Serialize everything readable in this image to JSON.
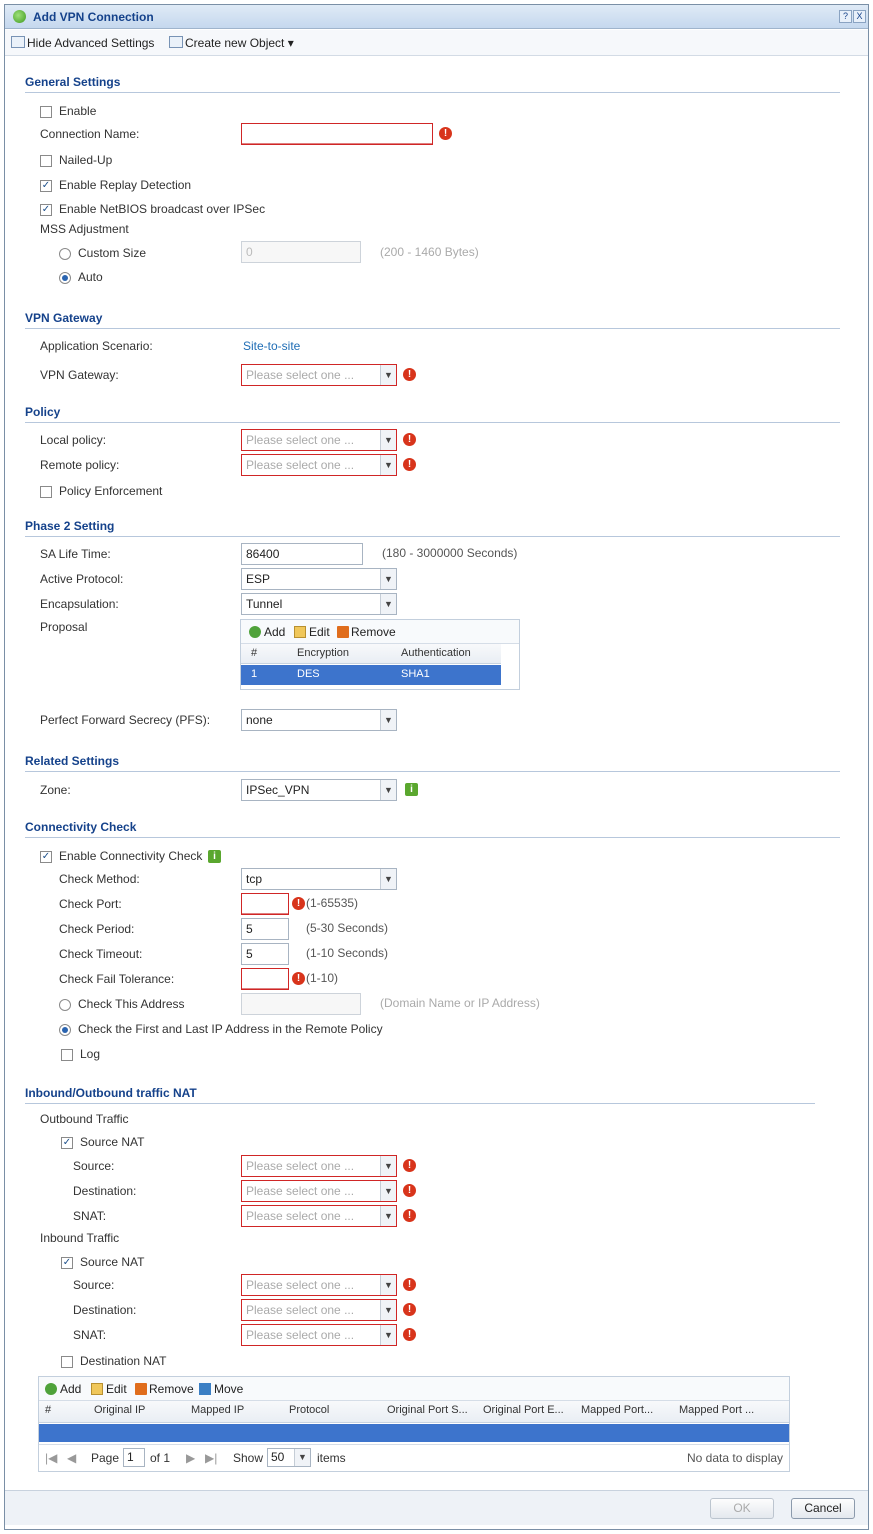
{
  "window": {
    "title": "Add VPN Connection",
    "help_label": "?",
    "close_label": "X"
  },
  "toolbar": {
    "hide_advanced": "Hide Advanced Settings",
    "create_object": "Create new Object"
  },
  "general": {
    "heading": "General Settings",
    "enable": "Enable",
    "connection_name_label": "Connection Name:",
    "nailed_up": "Nailed-Up",
    "replay_detection": "Enable Replay Detection",
    "netbios": "Enable NetBIOS broadcast over IPSec",
    "mss_label": "MSS Adjustment",
    "custom_size": "Custom Size",
    "custom_size_value": "0",
    "custom_size_hint": "(200 - 1460 Bytes)",
    "auto": "Auto"
  },
  "gateway": {
    "heading": "VPN Gateway",
    "scenario_label": "Application Scenario:",
    "scenario_value": "Site-to-site",
    "gateway_label": "VPN Gateway:",
    "placeholder": "Please select one ..."
  },
  "policy": {
    "heading": "Policy",
    "local_label": "Local policy:",
    "remote_label": "Remote policy:",
    "enforcement": "Policy Enforcement",
    "placeholder": "Please select one ..."
  },
  "phase2": {
    "heading": "Phase 2 Setting",
    "sa_label": "SA Life Time:",
    "sa_value": "86400",
    "sa_hint": "(180 - 3000000 Seconds)",
    "protocol_label": "Active Protocol:",
    "protocol_value": "ESP",
    "encap_label": "Encapsulation:",
    "encap_value": "Tunnel",
    "proposal_label": "Proposal",
    "add": "Add",
    "edit": "Edit",
    "remove": "Remove",
    "columns": [
      "#",
      "Encryption",
      "Authentication"
    ],
    "rows": [
      [
        "1",
        "DES",
        "SHA1"
      ]
    ],
    "pfs_label": "Perfect Forward Secrecy (PFS):",
    "pfs_value": "none"
  },
  "related": {
    "heading": "Related Settings",
    "zone_label": "Zone:",
    "zone_value": "IPSec_VPN"
  },
  "connectivity": {
    "heading": "Connectivity Check",
    "enable": "Enable Connectivity Check",
    "method_label": "Check Method:",
    "method_value": "tcp",
    "port_label": "Check Port:",
    "port_hint": "(1-65535)",
    "period_label": "Check Period:",
    "period_value": "5",
    "period_hint": "(5-30 Seconds)",
    "timeout_label": "Check Timeout:",
    "timeout_value": "5",
    "timeout_hint": "(1-10 Seconds)",
    "fail_label": "Check Fail Tolerance:",
    "fail_hint": "(1-10)",
    "address_label": "Check This Address",
    "address_hint": "(Domain Name or IP Address)",
    "first_last": "Check the First and Last IP Address in the Remote Policy",
    "log": "Log"
  },
  "nat": {
    "heading": "Inbound/Outbound traffic NAT",
    "outbound": "Outbound Traffic",
    "inbound": "Inbound Traffic",
    "source_nat": "Source NAT",
    "source": "Source:",
    "destination": "Destination:",
    "snat": "SNAT:",
    "destination_nat": "Destination NAT",
    "placeholder": "Please select one ...",
    "add": "Add",
    "edit": "Edit",
    "remove": "Remove",
    "move": "Move",
    "columns": [
      "#",
      "Original IP",
      "Mapped IP",
      "Protocol",
      "Original Port S...",
      "Original Port E...",
      "Mapped Port...",
      "Mapped Port ..."
    ],
    "page_label": "Page",
    "page_value": "1",
    "of_label": "of 1",
    "show_label": "Show",
    "show_value": "50",
    "items_label": "items",
    "no_data": "No data to display"
  },
  "footer": {
    "ok": "OK",
    "cancel": "Cancel"
  }
}
